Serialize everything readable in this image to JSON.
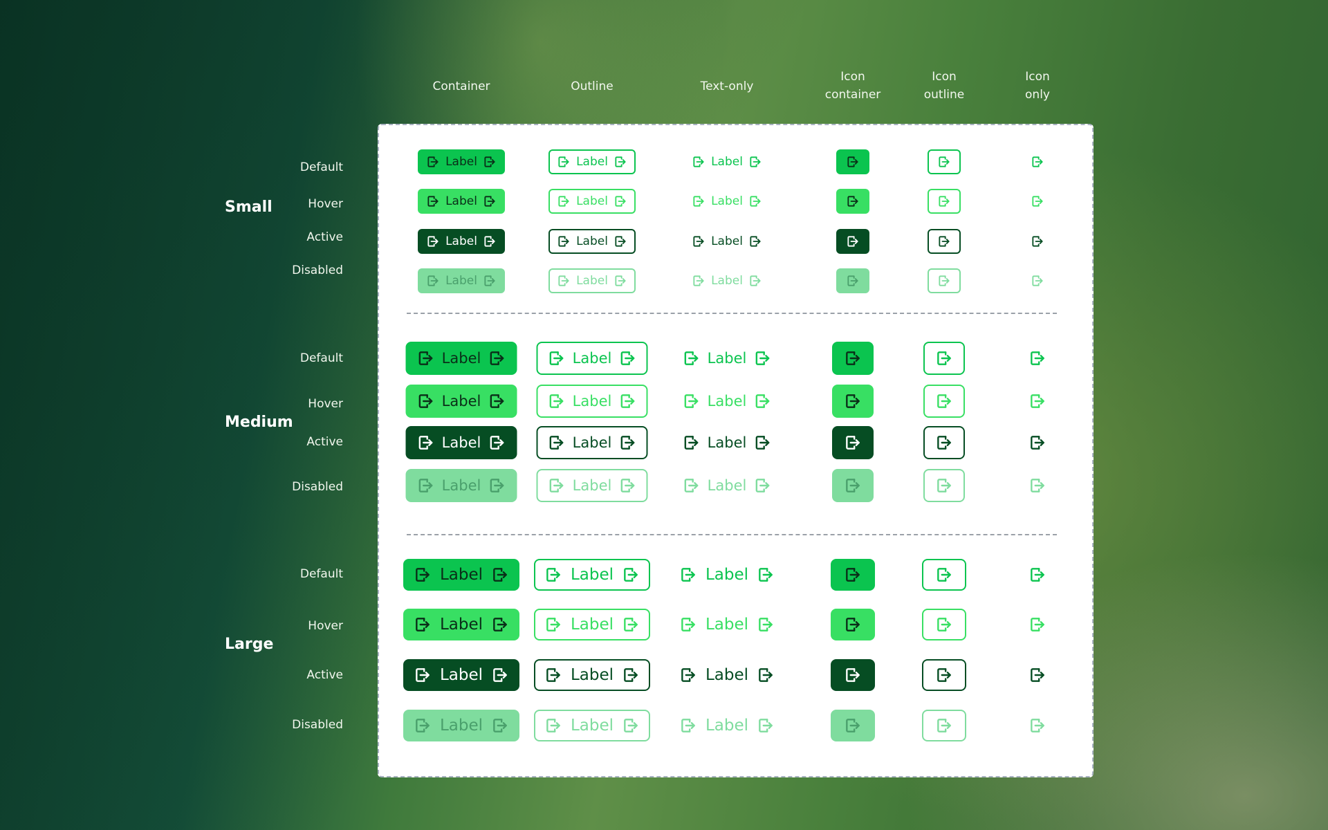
{
  "columns": [
    {
      "id": "container",
      "lines": [
        "Container"
      ]
    },
    {
      "id": "outline",
      "lines": [
        "Outline"
      ]
    },
    {
      "id": "text",
      "lines": [
        "Text-only"
      ]
    },
    {
      "id": "icon-container",
      "lines": [
        "Icon",
        "container"
      ]
    },
    {
      "id": "icon-outline",
      "lines": [
        "Icon",
        "outline"
      ]
    },
    {
      "id": "icon-only",
      "lines": [
        "Icon",
        "only"
      ]
    }
  ],
  "sizes": [
    {
      "id": "small",
      "name": "Small"
    },
    {
      "id": "medium",
      "name": "Medium"
    },
    {
      "id": "large",
      "name": "Large"
    }
  ],
  "states": [
    "Default",
    "Hover",
    "Active",
    "Disabled"
  ],
  "button_label": "Label",
  "icon": "logout-icon",
  "colors": {
    "default": "#0bc44f",
    "hover": "#38df63",
    "active": "#064d23",
    "disabled": "#7fdc9e",
    "disabled_text": "#4aa06c",
    "on_dark": "#ffffff",
    "on_bright": "#0a2e18",
    "panel": "#ffffff"
  }
}
